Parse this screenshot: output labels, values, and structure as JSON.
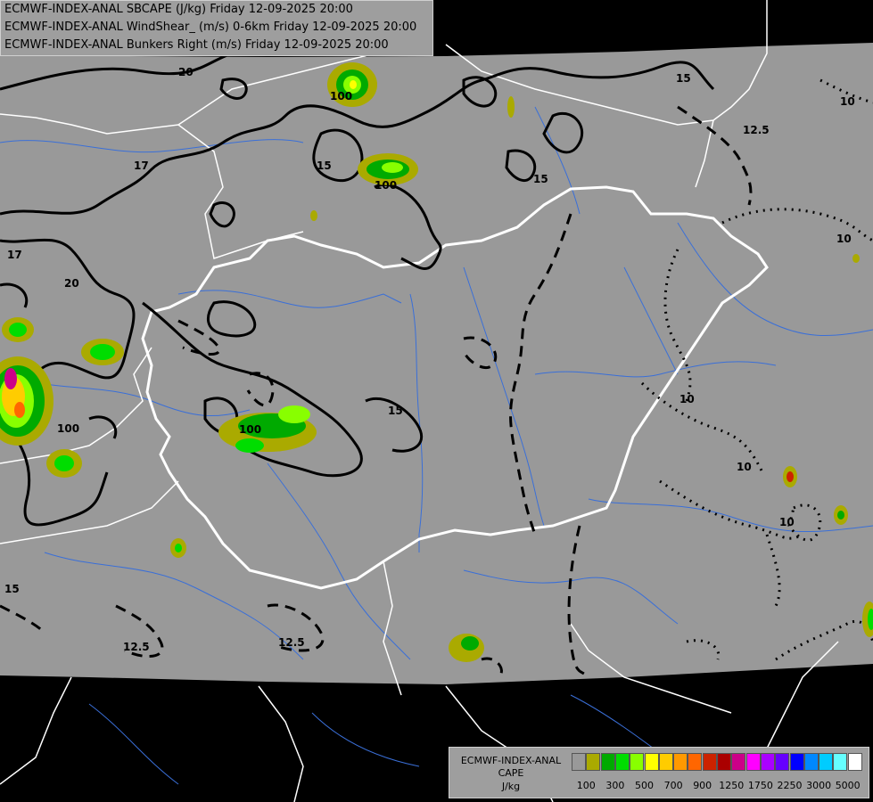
{
  "header": {
    "line1": "ECMWF-INDEX-ANAL SBCAPE (J/kg) Friday 12-09-2025 20:00",
    "line2": "ECMWF-INDEX-ANAL WindShear_ (m/s) 0-6km Friday 12-09-2025 20:00",
    "line3": "ECMWF-INDEX-ANAL Bunkers Right (m/s) Friday 12-09-2025 20:00"
  },
  "legend": {
    "title1": "ECMWF-INDEX-ANAL",
    "title2": "CAPE",
    "unit": "J/kg",
    "colors": [
      "#999999",
      "#aaaa00",
      "#00aa00",
      "#00dd00",
      "#88ff00",
      "#ffff00",
      "#ffcc00",
      "#ff9900",
      "#ff6600",
      "#cc2200",
      "#aa0000",
      "#cc0088",
      "#ff00ff",
      "#aa00ff",
      "#6600ff",
      "#0000ff",
      "#0088ff",
      "#00ccff",
      "#66ffff",
      "#ffffff"
    ],
    "ticks": [
      "100",
      "300",
      "500",
      "700",
      "900",
      "1250",
      "1750",
      "2250",
      "3000",
      "5000"
    ]
  },
  "map": {
    "colors": {
      "data_area": "#999999",
      "outside": "#000000",
      "borders": "#ffffff",
      "rivers": "#3a6fd8",
      "contours": "#000000"
    },
    "contour_labels": [
      "20",
      "20",
      "17",
      "17",
      "15",
      "15",
      "15",
      "15",
      "15",
      "12.5",
      "12.5",
      "12.5",
      "10",
      "10",
      "10",
      "10",
      "10",
      "100",
      "100",
      "100",
      "100"
    ]
  }
}
